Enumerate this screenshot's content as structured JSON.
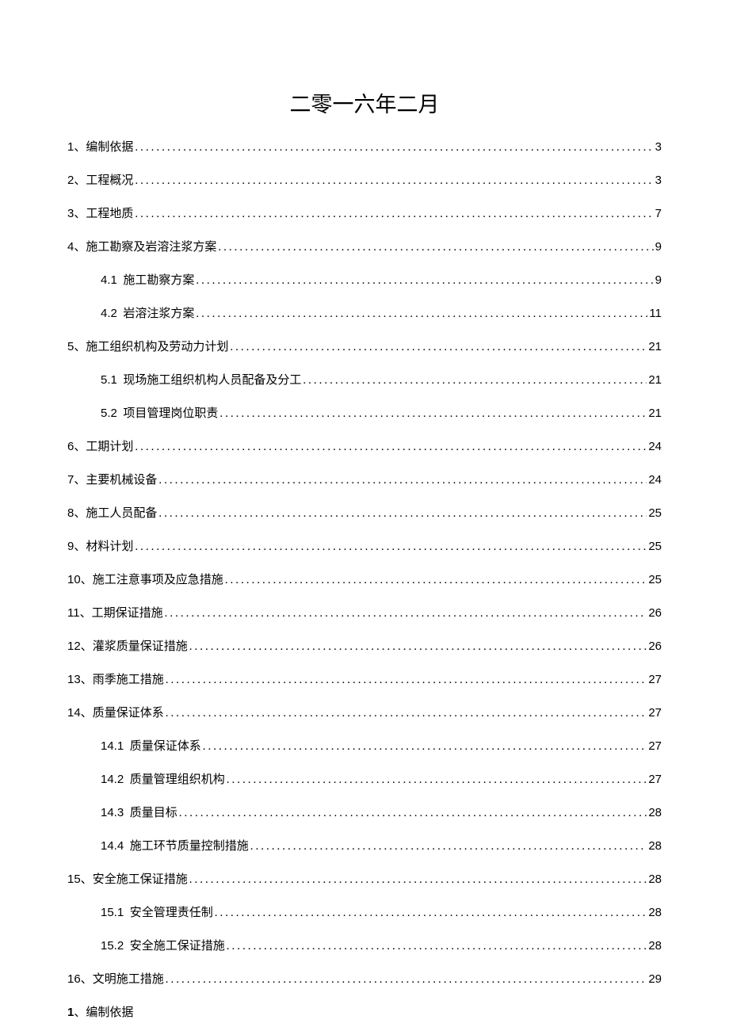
{
  "title": "二零一六年二月",
  "toc": [
    {
      "level": 1,
      "num_prefix": "1、",
      "label": "编制依据",
      "page": "3"
    },
    {
      "level": 1,
      "num_prefix": "2、",
      "label": "工程概况",
      "page": "3"
    },
    {
      "level": 1,
      "num_prefix": "3、",
      "label": "工程地质",
      "page": "7"
    },
    {
      "level": 1,
      "num_prefix": "4、",
      "label": "施工勘察及岩溶注浆方案",
      "page": "9"
    },
    {
      "level": 2,
      "num_prefix": "4.1",
      "label": "施工勘察方案",
      "page": "9"
    },
    {
      "level": 2,
      "num_prefix": "4.2",
      "label": "岩溶注浆方案",
      "page": "11"
    },
    {
      "level": 1,
      "num_prefix": "5、",
      "label": "施工组织机构及劳动力计划",
      "page": "21"
    },
    {
      "level": 2,
      "num_prefix": "5.1",
      "label": "现场施工组织机构人员配备及分工",
      "page": "21"
    },
    {
      "level": 2,
      "num_prefix": "5.2",
      "label": "项目管理岗位职责",
      "page": "21"
    },
    {
      "level": 1,
      "num_prefix": "6、",
      "label": "工期计划",
      "page": "24"
    },
    {
      "level": 1,
      "num_prefix": "7、",
      "label": "主要机械设备",
      "page": "24"
    },
    {
      "level": 1,
      "num_prefix": "8、",
      "label": "施工人员配备",
      "page": "25"
    },
    {
      "level": 1,
      "num_prefix": "9、",
      "label": "材料计划",
      "page": "25"
    },
    {
      "level": 1,
      "num_prefix": "10、",
      "label": "施工注意事项及应急措施",
      "page": "25"
    },
    {
      "level": 1,
      "num_prefix": "11、",
      "label": "工期保证措施",
      "page": "26"
    },
    {
      "level": 1,
      "num_prefix": "12、",
      "label": "灌浆质量保证措施",
      "page": "26"
    },
    {
      "level": 1,
      "num_prefix": "13、",
      "label": "雨季施工措施",
      "page": "27"
    },
    {
      "level": 1,
      "num_prefix": "14、",
      "label": "质量保证体系",
      "page": "27"
    },
    {
      "level": 2,
      "num_prefix": "14.1",
      "label": "质量保证体系",
      "page": "27"
    },
    {
      "level": 2,
      "num_prefix": "14.2",
      "label": "质量管理组织机构",
      "page": "27"
    },
    {
      "level": 2,
      "num_prefix": "14.3",
      "label": "质量目标",
      "page": "28"
    },
    {
      "level": 2,
      "num_prefix": "14.4",
      "label": "施工环节质量控制措施",
      "page": "28"
    },
    {
      "level": 1,
      "num_prefix": "15、",
      "label": "安全施工保证措施",
      "page": "28"
    },
    {
      "level": 2,
      "num_prefix": "15.1",
      "label": "安全管理责任制",
      "page": "28"
    },
    {
      "level": 2,
      "num_prefix": "15.2",
      "label": "安全施工保证措施",
      "page": "28"
    },
    {
      "level": 1,
      "num_prefix": "16、",
      "label": "文明施工措施",
      "page": "29"
    }
  ],
  "section_heading": {
    "num": "1",
    "sep": "、",
    "text": "编制依据"
  }
}
